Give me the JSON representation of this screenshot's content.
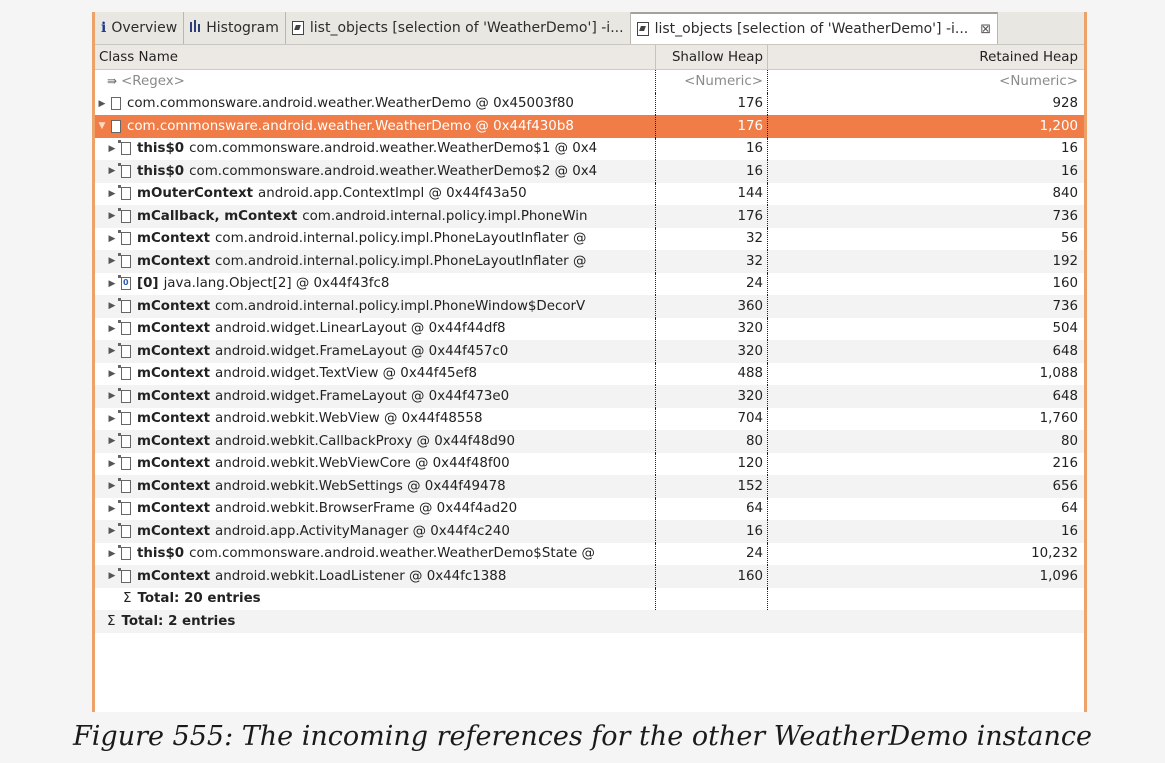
{
  "tabs": [
    {
      "icon": "i",
      "label": "Overview"
    },
    {
      "icon": "histogram-icon",
      "label": "Histogram"
    },
    {
      "icon": "list-icon",
      "label": "list_objects [selection of 'WeatherDemo'] -i..."
    },
    {
      "icon": "list-icon",
      "label": "list_objects [selection of 'WeatherDemo'] -i...",
      "active": true
    }
  ],
  "close_glyph": "⊠",
  "columns": {
    "class_name": "Class Name",
    "shallow": "Shallow Heap",
    "retained": "Retained Heap"
  },
  "filter": {
    "regex": "<Regex>",
    "numeric1": "<Numeric>",
    "numeric2": "<Numeric>"
  },
  "rows": [
    {
      "level": 0,
      "expanded": false,
      "field": "",
      "name": "com.commonsware.android.weather.WeatherDemo @ 0x45003f80",
      "shallow": "176",
      "retained": "928"
    },
    {
      "level": 0,
      "expanded": true,
      "selected": true,
      "field": "",
      "name": "com.commonsware.android.weather.WeatherDemo @ 0x44f430b8",
      "shallow": "176",
      "retained": "1,200"
    },
    {
      "level": 1,
      "field": "this$0",
      "name": "com.commonsware.android.weather.WeatherDemo$1 @ 0x4",
      "shallow": "16",
      "retained": "16"
    },
    {
      "level": 1,
      "field": "this$0",
      "name": "com.commonsware.android.weather.WeatherDemo$2 @ 0x4",
      "shallow": "16",
      "retained": "16"
    },
    {
      "level": 1,
      "field": "mOuterContext",
      "name": "android.app.ContextImpl @ 0x44f43a50",
      "shallow": "144",
      "retained": "840"
    },
    {
      "level": 1,
      "field": "mCallback, mContext",
      "name": "com.android.internal.policy.impl.PhoneWin",
      "shallow": "176",
      "retained": "736"
    },
    {
      "level": 1,
      "field": "mContext",
      "name": "com.android.internal.policy.impl.PhoneLayoutInflater @",
      "shallow": "32",
      "retained": "56"
    },
    {
      "level": 1,
      "field": "mContext",
      "name": "com.android.internal.policy.impl.PhoneLayoutInflater @",
      "shallow": "32",
      "retained": "192"
    },
    {
      "level": 1,
      "array": true,
      "field": "[0]",
      "name": "java.lang.Object[2] @ 0x44f43fc8",
      "shallow": "24",
      "retained": "160"
    },
    {
      "level": 1,
      "field": "mContext",
      "name": "com.android.internal.policy.impl.PhoneWindow$DecorV",
      "shallow": "360",
      "retained": "736"
    },
    {
      "level": 1,
      "field": "mContext",
      "name": "android.widget.LinearLayout @ 0x44f44df8",
      "shallow": "320",
      "retained": "504"
    },
    {
      "level": 1,
      "field": "mContext",
      "name": "android.widget.FrameLayout @ 0x44f457c0",
      "shallow": "320",
      "retained": "648"
    },
    {
      "level": 1,
      "field": "mContext",
      "name": "android.widget.TextView @ 0x44f45ef8",
      "shallow": "488",
      "retained": "1,088"
    },
    {
      "level": 1,
      "field": "mContext",
      "name": "android.widget.FrameLayout @ 0x44f473e0",
      "shallow": "320",
      "retained": "648"
    },
    {
      "level": 1,
      "field": "mContext",
      "name": "android.webkit.WebView @ 0x44f48558",
      "shallow": "704",
      "retained": "1,760"
    },
    {
      "level": 1,
      "field": "mContext",
      "name": "android.webkit.CallbackProxy @ 0x44f48d90",
      "shallow": "80",
      "retained": "80"
    },
    {
      "level": 1,
      "field": "mContext",
      "name": "android.webkit.WebViewCore @ 0x44f48f00",
      "shallow": "120",
      "retained": "216"
    },
    {
      "level": 1,
      "field": "mContext",
      "name": "android.webkit.WebSettings @ 0x44f49478",
      "shallow": "152",
      "retained": "656"
    },
    {
      "level": 1,
      "field": "mContext",
      "name": "android.webkit.BrowserFrame @ 0x44f4ad20",
      "shallow": "64",
      "retained": "64"
    },
    {
      "level": 1,
      "field": "mContext",
      "name": "android.app.ActivityManager @ 0x44f4c240",
      "shallow": "16",
      "retained": "16"
    },
    {
      "level": 1,
      "field": "this$0",
      "name": "com.commonsware.android.weather.WeatherDemo$State @",
      "shallow": "24",
      "retained": "10,232"
    },
    {
      "level": 1,
      "field": "mContext",
      "name": "android.webkit.LoadListener @ 0x44fc1388",
      "shallow": "160",
      "retained": "1,096"
    }
  ],
  "totals": {
    "inner": "Total: 20 entries",
    "outer": "Total: 2 entries",
    "sigma": "Σ"
  },
  "caption": "Figure 555: The incoming references for the other WeatherDemo instance"
}
